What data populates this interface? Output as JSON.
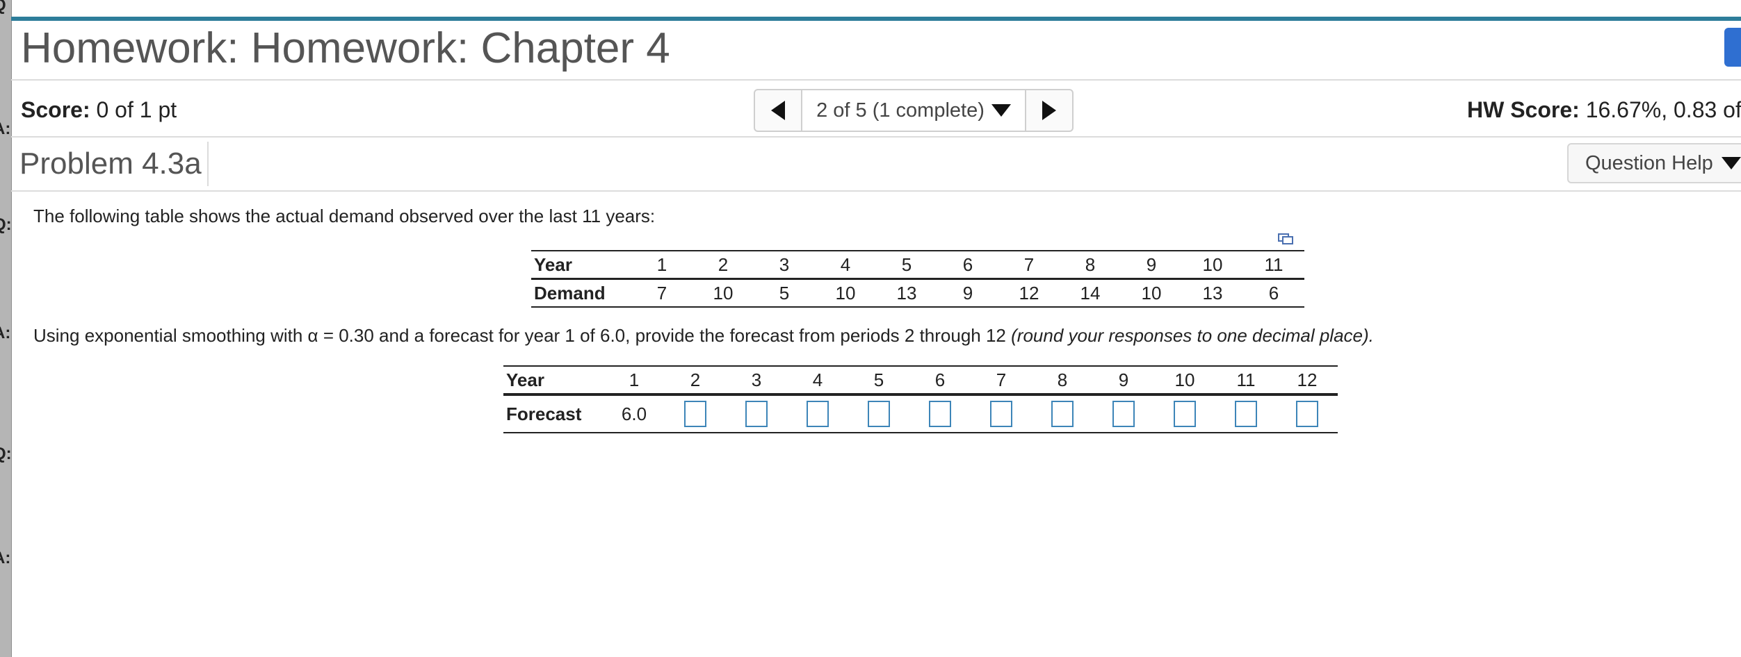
{
  "header": {
    "title": "Homework: Homework: Chapter 4"
  },
  "scorebar": {
    "score_label": "Score:",
    "score_value": "0 of 1 pt",
    "question_selector": "2 of 5 (1 complete)",
    "hw_score_label": "HW Score:",
    "hw_score_value": "16.67%, 0.83 of"
  },
  "problem": {
    "title": "Problem 4.3a",
    "help_label": "Question Help",
    "intro_text": "The following table shows the actual demand observed over the last 11 years:",
    "instructions": "Using exponential smoothing with α = 0.30 and a forecast for year 1 of 6.0, provide the forecast from periods 2 through 12",
    "instructions_italic": "(round your responses to one decimal place)."
  },
  "demand_table": {
    "row_labels": [
      "Year",
      "Demand"
    ],
    "years": [
      "1",
      "2",
      "3",
      "4",
      "5",
      "6",
      "7",
      "8",
      "9",
      "10",
      "11"
    ],
    "demand": [
      "7",
      "10",
      "5",
      "10",
      "13",
      "9",
      "12",
      "14",
      "10",
      "13",
      "6"
    ]
  },
  "forecast_table": {
    "row_labels": [
      "Year",
      "Forecast"
    ],
    "years": [
      "1",
      "2",
      "3",
      "4",
      "5",
      "6",
      "7",
      "8",
      "9",
      "10",
      "11",
      "12"
    ],
    "forecast_given": "6.0",
    "forecast_inputs": [
      "",
      "",
      "",
      "",
      "",
      "",
      "",
      "",
      "",
      "",
      ""
    ]
  },
  "sidebar": {
    "strip_labels": [
      "Q",
      "A:",
      "Q:",
      "A:",
      "Q:",
      "A:"
    ]
  },
  "colors": {
    "accent": "#2d7d9a",
    "input_border": "#3d85b8",
    "corner_button": "#2f6fd1"
  }
}
